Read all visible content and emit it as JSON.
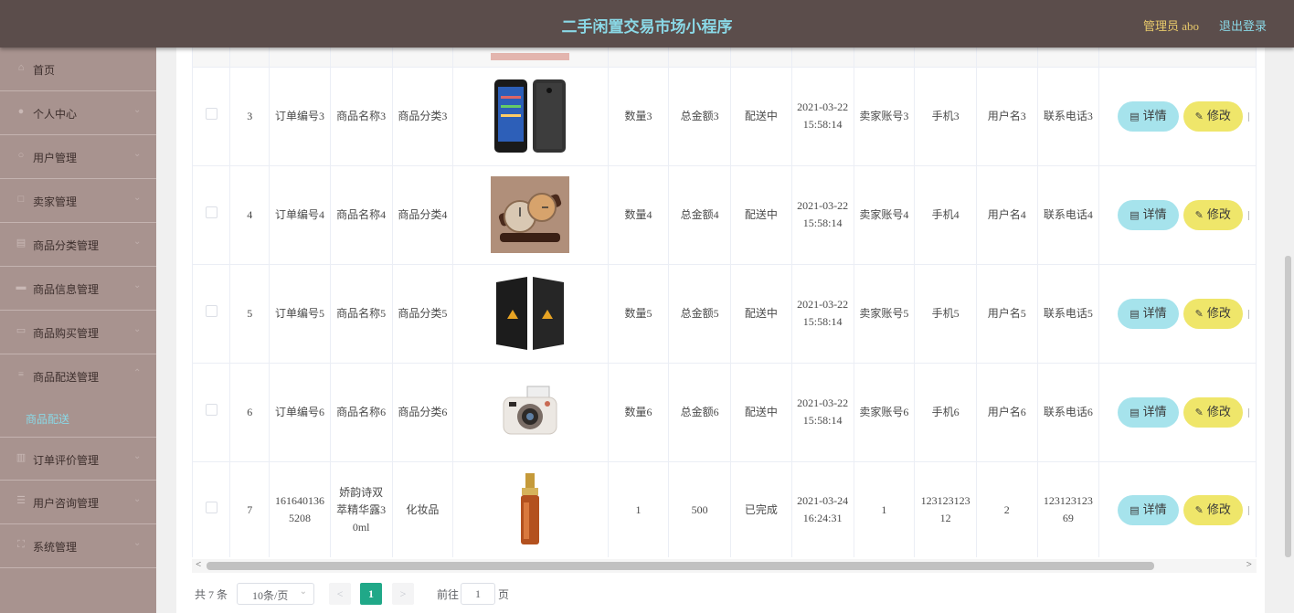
{
  "header": {
    "title": "二手闲置交易市场小程序",
    "admin_label": "管理员 abo",
    "logout_label": "退出登录"
  },
  "sidebar": {
    "items": [
      {
        "label": "首页",
        "icon": "home-icon"
      },
      {
        "label": "个人中心",
        "icon": "user-icon"
      },
      {
        "label": "用户管理",
        "icon": "users-icon"
      },
      {
        "label": "卖家管理",
        "icon": "seller-icon"
      },
      {
        "label": "商品分类管理",
        "icon": "category-icon"
      },
      {
        "label": "商品信息管理",
        "icon": "goods-icon"
      },
      {
        "label": "商品购买管理",
        "icon": "cart-icon"
      },
      {
        "label": "商品配送管理",
        "icon": "delivery-icon"
      },
      {
        "label": "订单评价管理",
        "icon": "review-icon"
      },
      {
        "label": "用户咨询管理",
        "icon": "consult-icon"
      },
      {
        "label": "系统管理",
        "icon": "settings-icon"
      }
    ],
    "active_sub": "商品配送"
  },
  "table": {
    "rows": [
      {
        "index": "3",
        "order_no": "订单编号3",
        "name": "商品名称3",
        "category": "商品分类3",
        "image": "phone-image",
        "qty": "数量3",
        "total": "总金额3",
        "status": "配送中",
        "time": "2021-03-22 15:58:14",
        "seller": "卖家账号3",
        "phone": "手机3",
        "user": "用户名3",
        "tel": "联系电话3"
      },
      {
        "index": "4",
        "order_no": "订单编号4",
        "name": "商品名称4",
        "category": "商品分类4",
        "image": "watch-image",
        "qty": "数量4",
        "total": "总金额4",
        "status": "配送中",
        "time": "2021-03-22 15:58:14",
        "seller": "卖家账号4",
        "phone": "手机4",
        "user": "用户名4",
        "tel": "联系电话4"
      },
      {
        "index": "5",
        "order_no": "订单编号5",
        "name": "商品名称5",
        "category": "商品分类5",
        "image": "speaker-image",
        "qty": "数量5",
        "total": "总金额5",
        "status": "配送中",
        "time": "2021-03-22 15:58:14",
        "seller": "卖家账号5",
        "phone": "手机5",
        "user": "用户名5",
        "tel": "联系电话5"
      },
      {
        "index": "6",
        "order_no": "订单编号6",
        "name": "商品名称6",
        "category": "商品分类6",
        "image": "camera-image",
        "qty": "数量6",
        "total": "总金额6",
        "status": "配送中",
        "time": "2021-03-22 15:58:14",
        "seller": "卖家账号6",
        "phone": "手机6",
        "user": "用户名6",
        "tel": "联系电话6"
      },
      {
        "index": "7",
        "order_no": "1616401365208",
        "name": "娇韵诗双萃精华露30ml",
        "category": "化妆品",
        "image": "serum-image",
        "qty": "1",
        "total": "500",
        "status": "已完成",
        "time": "2021-03-24 16:24:31",
        "seller": "1",
        "phone": "12312312312",
        "user": "2",
        "tel": "12312312369"
      }
    ],
    "actions": {
      "detail_label": "详情",
      "edit_label": "修改"
    }
  },
  "pagination": {
    "total_text": "共 7 条",
    "page_size": "10条/页",
    "current_page": "1",
    "goto_prefix": "前往",
    "goto_value": "1",
    "goto_suffix": "页"
  }
}
